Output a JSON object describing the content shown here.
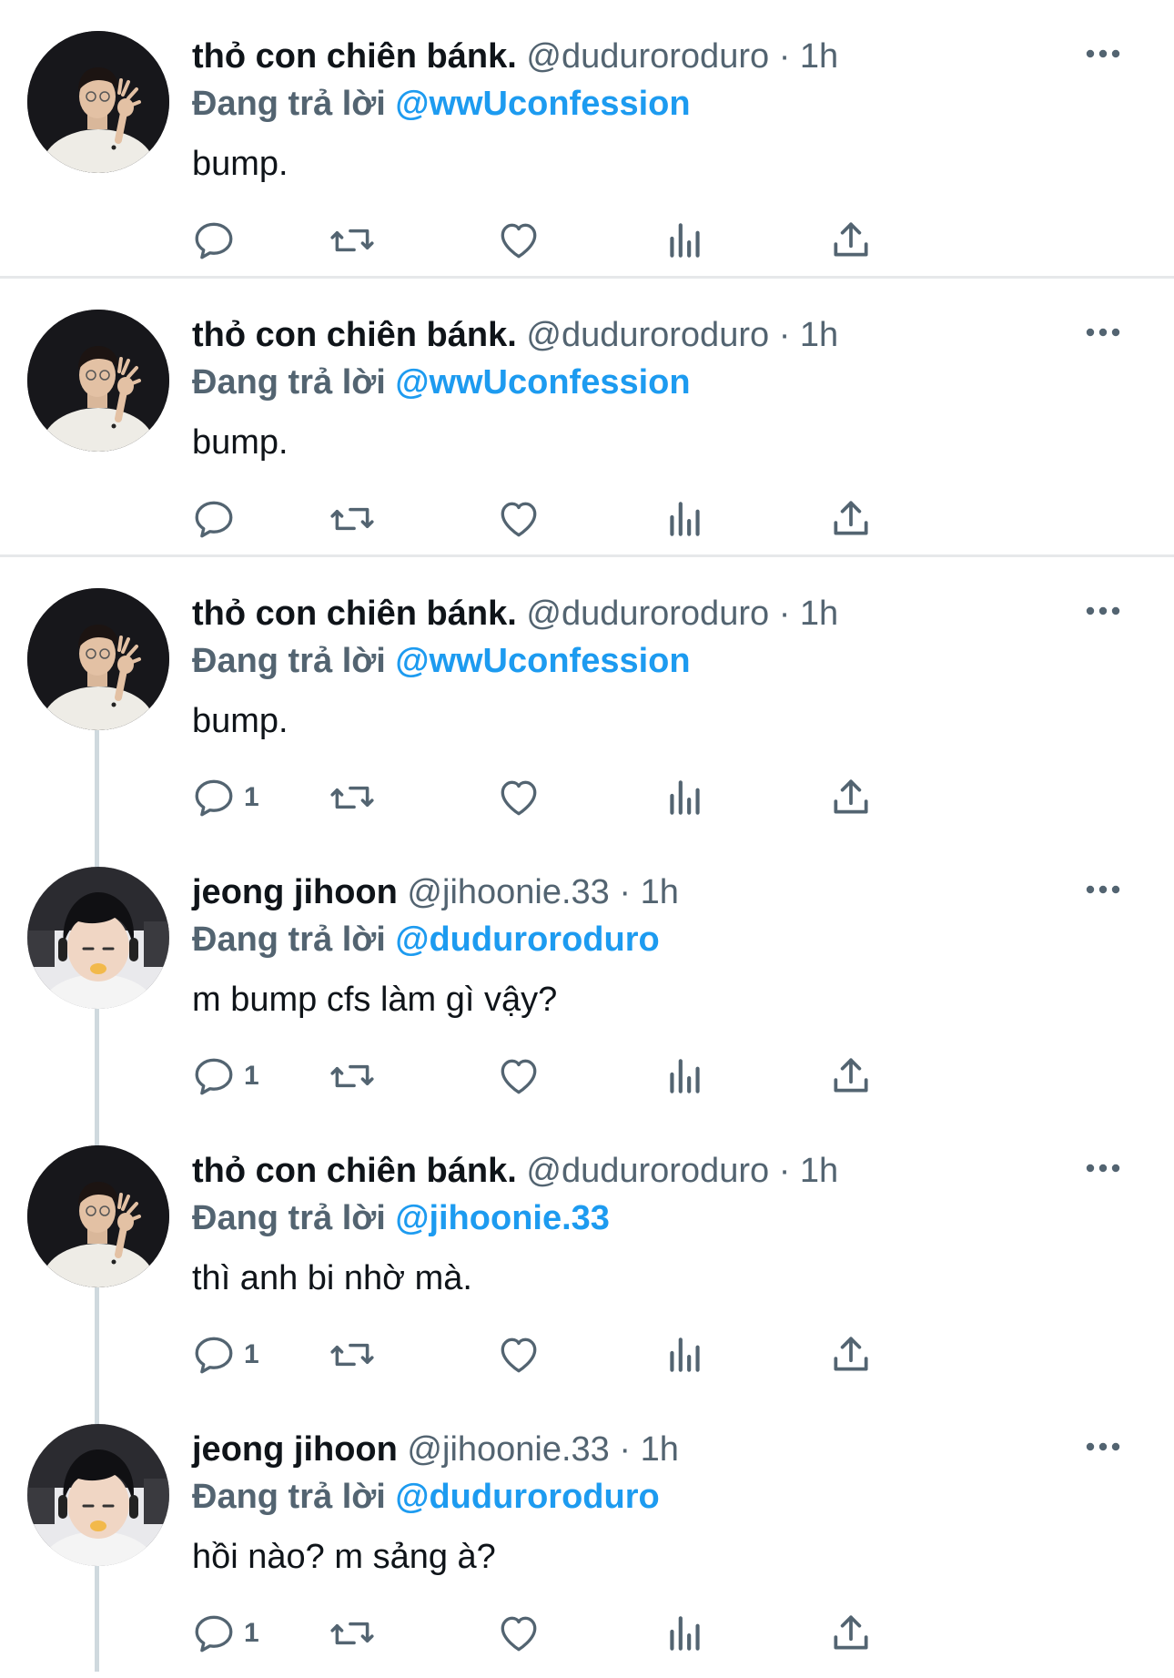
{
  "colors": {
    "accent": "#1d9bf0",
    "secondary_text": "#536471",
    "primary_text": "#0f1419",
    "divider": "#e6e8ea",
    "thread_line": "#cfd9de"
  },
  "tweets": [
    {
      "name": "thỏ con chiên bánk.",
      "handle": "@duduroroduro",
      "time": "1h",
      "sep": "·",
      "reply_label": "Đang trả lời",
      "reply_to": "@wwUconfession",
      "text": "bump.",
      "reply_count": "",
      "avatar": "avatar-man-white-shirt"
    },
    {
      "name": "thỏ con chiên bánk.",
      "handle": "@duduroroduro",
      "time": "1h",
      "sep": "·",
      "reply_label": "Đang trả lời",
      "reply_to": "@wwUconfession",
      "text": "bump.",
      "reply_count": "",
      "avatar": "avatar-man-white-shirt"
    },
    {
      "name": "thỏ con chiên bánk.",
      "handle": "@duduroroduro",
      "time": "1h",
      "sep": "·",
      "reply_label": "Đang trả lời",
      "reply_to": "@wwUconfession",
      "text": "bump.",
      "reply_count": "1",
      "avatar": "avatar-man-white-shirt"
    },
    {
      "name": "jeong jihoon",
      "handle": "@jihoonie.33",
      "time": "1h",
      "sep": "·",
      "reply_label": "Đang trả lời",
      "reply_to": "@duduroroduro",
      "text": "m bump cfs làm gì vậy?",
      "reply_count": "1",
      "avatar": "avatar-boy-headphones"
    },
    {
      "name": "thỏ con chiên bánk.",
      "handle": "@duduroroduro",
      "time": "1h",
      "sep": "·",
      "reply_label": "Đang trả lời",
      "reply_to": "@jihoonie.33",
      "text": "thì anh bi nhờ mà.",
      "reply_count": "1",
      "avatar": "avatar-man-white-shirt"
    },
    {
      "name": "jeong jihoon",
      "handle": "@jihoonie.33",
      "time": "1h",
      "sep": "·",
      "reply_label": "Đang trả lời",
      "reply_to": "@duduroroduro",
      "text": "hồi nào? m sảng à?",
      "reply_count": "1",
      "avatar": "avatar-boy-headphones"
    }
  ],
  "icons": {
    "reply": "speech-bubble-icon",
    "retweet": "retweet-arrows-icon",
    "like": "heart-icon",
    "views": "bar-chart-icon",
    "share": "share-upload-icon",
    "more": "three-dots-icon"
  }
}
